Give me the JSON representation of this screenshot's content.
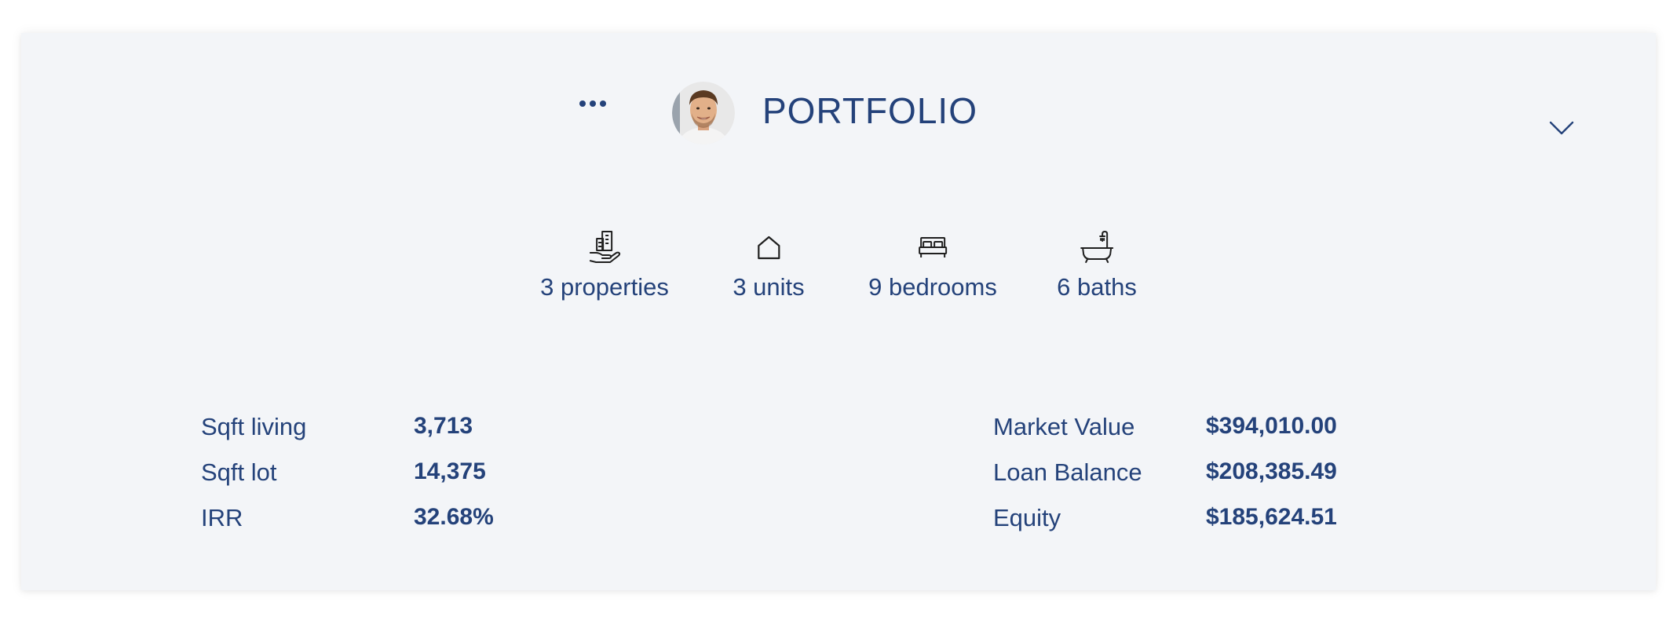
{
  "header": {
    "title": "PORTFOLIO",
    "avatar_icon": "user-avatar-photo",
    "more_icon": "more-horizontal-icon",
    "collapse_icon": "chevron-down-icon"
  },
  "stats": [
    {
      "icon": "building-hand-icon",
      "label": "3 properties"
    },
    {
      "icon": "house-icon",
      "label": "3 units"
    },
    {
      "icon": "bed-icon",
      "label": "9 bedrooms"
    },
    {
      "icon": "bathtub-icon",
      "label": "6 baths"
    }
  ],
  "details_left": [
    {
      "label": "Sqft living",
      "value": "3,713"
    },
    {
      "label": "Sqft lot",
      "value": "14,375"
    },
    {
      "label": "IRR",
      "value": "32.68%"
    }
  ],
  "details_right": [
    {
      "label": "Market Value",
      "value": "$394,010.00"
    },
    {
      "label": "Loan Balance",
      "value": "$208,385.49"
    },
    {
      "label": "Equity",
      "value": "$185,624.51"
    }
  ],
  "colors": {
    "accent": "#24427a",
    "card_background": "#f3f5f8",
    "page_background": "#ffffff"
  }
}
